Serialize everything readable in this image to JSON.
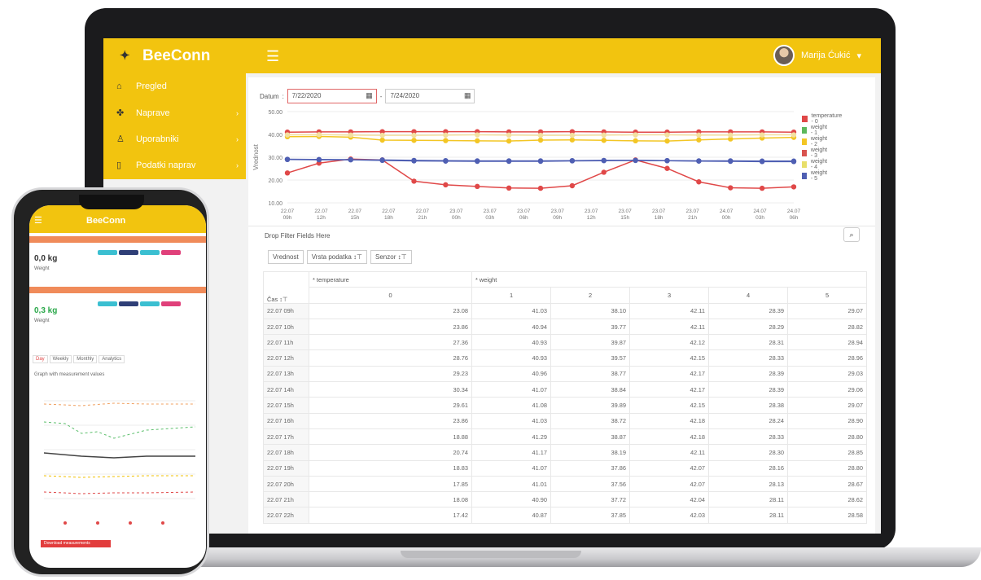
{
  "app": {
    "name": "BeeConn"
  },
  "user": {
    "name": "Marija Ćukić"
  },
  "sidebar": {
    "items": [
      {
        "label": "Pregled",
        "icon": "home-icon"
      },
      {
        "label": "Naprave",
        "icon": "devices-icon"
      },
      {
        "label": "Uporabniki",
        "icon": "user-icon"
      },
      {
        "label": "Podatki naprav",
        "icon": "document-icon"
      }
    ]
  },
  "filter": {
    "label": "Datum",
    "from": "7/22/2020",
    "to": "7/24/2020"
  },
  "chart_data": {
    "type": "line",
    "ylabel": "Vrednost",
    "ylim": [
      10,
      50
    ],
    "yticks": [
      "50.00",
      "40.00",
      "30.00",
      "20.00",
      "10.00"
    ],
    "categories": [
      "22.07 09h",
      "22.07 12h",
      "22.07 15h",
      "22.07 18h",
      "22.07 21h",
      "23.07 00h",
      "23.07 03h",
      "23.07 06h",
      "23.07 09h",
      "23.07 12h",
      "23.07 15h",
      "23.07 18h",
      "23.07 21h",
      "24.07 00h",
      "24.07 03h",
      "24.07 06h"
    ],
    "series": [
      {
        "name": "temperature - 0",
        "color": "#e04848",
        "values": [
          23.1,
          27.4,
          29.2,
          28.8,
          19.5,
          17.9,
          17.2,
          16.5,
          16.4,
          17.5,
          23.4,
          28.8,
          25.1,
          19.2,
          16.6,
          16.4,
          17.0
        ]
      },
      {
        "name": "weight - 1",
        "color": "#e04848",
        "values": [
          41.0,
          41.1,
          41.1,
          41.2,
          41.2,
          41.2,
          41.2,
          41.1,
          41.1,
          41.2,
          41.1,
          41.0,
          41.0,
          41.1,
          41.1,
          41.1,
          41.0
        ]
      },
      {
        "name": "weight - 2",
        "color": "#f3c625",
        "values": [
          39.0,
          39.1,
          38.8,
          37.5,
          37.4,
          37.3,
          37.2,
          37.1,
          37.5,
          37.6,
          37.4,
          37.2,
          37.1,
          37.6,
          38.0,
          38.4,
          38.7
        ]
      },
      {
        "name": "weight - 3",
        "color": "#f3e0a0",
        "values": [
          39.8,
          39.9,
          39.7,
          39.6,
          39.6,
          39.7,
          39.8,
          39.7,
          39.6,
          39.6,
          39.7,
          39.8,
          39.8,
          39.7,
          39.7,
          39.8,
          39.8
        ]
      },
      {
        "name": "weight - 4",
        "color": "#4f5fb3",
        "values": [
          29.1,
          29.0,
          28.9,
          28.6,
          28.4,
          28.3,
          28.2,
          28.2,
          28.2,
          28.4,
          28.5,
          28.6,
          28.5,
          28.3,
          28.2,
          28.1,
          28.1
        ]
      },
      {
        "name": "weight - 5",
        "color": "#4f5fb3",
        "values": [
          29.0,
          28.9,
          28.9,
          28.8,
          28.6,
          28.5,
          28.4,
          28.4,
          28.4,
          28.5,
          28.6,
          28.6,
          28.5,
          28.4,
          28.4,
          28.3,
          28.3
        ]
      }
    ],
    "legend_colors": [
      "#e04848",
      "#5cb85c",
      "#f3c625",
      "#d9534f",
      "#e8df6a",
      "#4f5fb3"
    ],
    "legend_position": "right"
  },
  "pivot": {
    "drop_label": "Drop Filter Fields Here",
    "chips": [
      "Vrednost",
      "Vrsta podatka",
      "Senzor"
    ],
    "row_header": "Čas",
    "group_headers": [
      "* temperature",
      "* weight"
    ],
    "column_headers": [
      "0",
      "1",
      "2",
      "3",
      "4",
      "5"
    ],
    "rows": [
      [
        "22.07 09h",
        "23.08",
        "41.03",
        "38.10",
        "42.11",
        "28.39",
        "29.07"
      ],
      [
        "22.07 10h",
        "23.86",
        "40.94",
        "39.77",
        "42.11",
        "28.29",
        "28.82"
      ],
      [
        "22.07 11h",
        "27.36",
        "40.93",
        "39.87",
        "42.12",
        "28.31",
        "28.94"
      ],
      [
        "22.07 12h",
        "28.76",
        "40.93",
        "39.57",
        "42.15",
        "28.33",
        "28.96"
      ],
      [
        "22.07 13h",
        "29.23",
        "40.96",
        "38.77",
        "42.17",
        "28.39",
        "29.03"
      ],
      [
        "22.07 14h",
        "30.34",
        "41.07",
        "38.84",
        "42.17",
        "28.39",
        "29.06"
      ],
      [
        "22.07 15h",
        "29.61",
        "41.08",
        "39.89",
        "42.15",
        "28.38",
        "29.07"
      ],
      [
        "22.07 16h",
        "23.86",
        "41.03",
        "38.72",
        "42.18",
        "28.24",
        "28.90"
      ],
      [
        "22.07 17h",
        "18.88",
        "41.29",
        "38.87",
        "42.18",
        "28.33",
        "28.80"
      ],
      [
        "22.07 18h",
        "20.74",
        "41.17",
        "38.19",
        "42.11",
        "28.30",
        "28.85"
      ],
      [
        "22.07 19h",
        "18.83",
        "41.07",
        "37.86",
        "42.07",
        "28.16",
        "28.80"
      ],
      [
        "22.07 20h",
        "17.85",
        "41.01",
        "37.56",
        "42.07",
        "28.13",
        "28.67"
      ],
      [
        "22.07 21h",
        "18.08",
        "40.90",
        "37.72",
        "42.04",
        "28.11",
        "28.62"
      ],
      [
        "22.07 22h",
        "17.42",
        "40.87",
        "37.85",
        "42.03",
        "28.11",
        "28.58"
      ]
    ]
  },
  "phone": {
    "app_name": "BeeConn",
    "card1": {
      "value": "0,0 kg",
      "caption": "Weight"
    },
    "card2": {
      "value": "0,3 kg",
      "caption": "Weight"
    },
    "tabs": [
      "Day",
      "Weekly",
      "Monthly",
      "Analytics"
    ],
    "chart_caption": "Graph with measurement values",
    "button_label": "Download measurements"
  }
}
